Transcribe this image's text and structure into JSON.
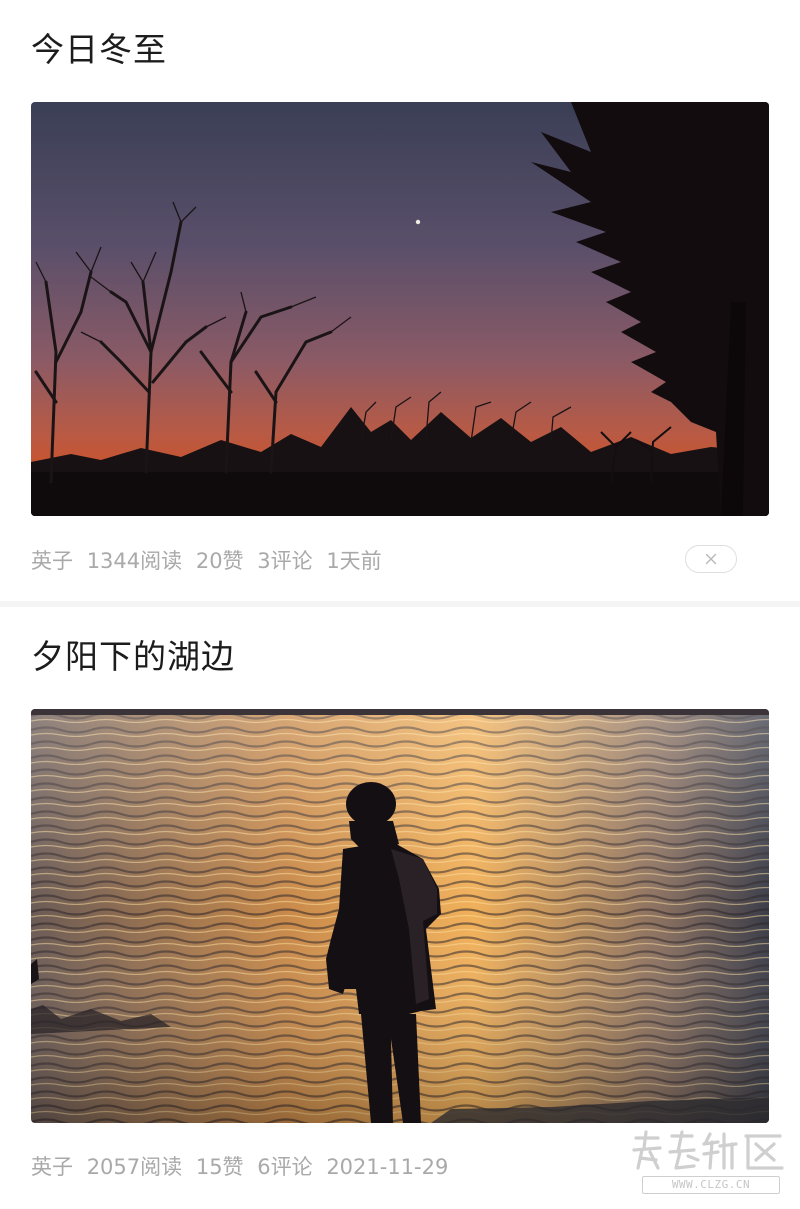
{
  "posts": [
    {
      "title": "今日冬至",
      "photo_subject": "sunset-silhouette-trees",
      "meta": {
        "author": "英子",
        "reads": "1344阅读",
        "likes": "20赞",
        "comments": "3评论",
        "time": "1天前"
      },
      "dismiss_icon": "close-icon"
    },
    {
      "title": "夕阳下的湖边",
      "photo_subject": "lake-sunset-silhouette-person",
      "meta": {
        "author": "英子",
        "reads": "2057阅读",
        "likes": "15赞",
        "comments": "6评论",
        "time": "2021-11-29"
      }
    }
  ],
  "watermark": {
    "logo_text": "彩龙社区",
    "url": "WWW.CLZG.CN"
  },
  "colors": {
    "title": "#1c1c1c",
    "meta": "#a9a9a9",
    "divider": "#f4f4f4",
    "sky_top": "#3a3f55",
    "sky_glow": "#c8542e",
    "water_gold": "#f0b05a"
  }
}
